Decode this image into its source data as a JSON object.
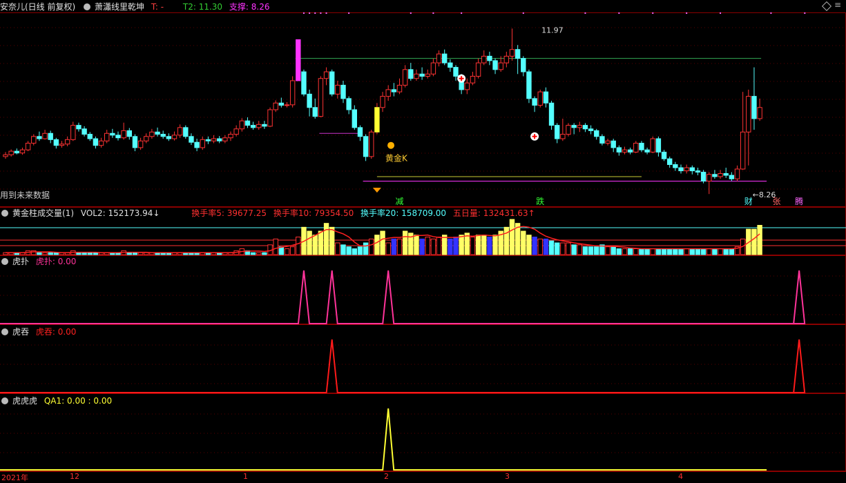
{
  "main": {
    "title": "安奈儿(日线 前复权)",
    "indicator": "萧瀟线里乾坤",
    "t_label": "T: -",
    "t2_label": "T2: 11.30",
    "support_label": "支撑: 8.26",
    "high_label": "11.97",
    "low_label": "8.26",
    "future_text": "用到未来数据",
    "golden_k": "黄金K",
    "sign_jian": "减",
    "sign_die": "跌",
    "sign_cai": "财",
    "sign_zhang": "张",
    "sign_teng": "腾"
  },
  "volume_panel": {
    "title": "黄金柱成交量(1)",
    "vol2": "VOL2: 152173.94↓",
    "hs5": "换手率5: 39677.25",
    "hs10": "换手率10: 79354.50",
    "hs20": "换手率20: 158709.00",
    "wr": "五日量: 132431.63↑"
  },
  "hupu_panel": {
    "title": "虎扑",
    "value": "虎扑: 0.00"
  },
  "hutun_panel": {
    "title": "虎吞",
    "value": "虎吞: 0.00"
  },
  "huhuhu_panel": {
    "title": "虎虎虎",
    "value": "QA1: 0.00 : 0.00"
  },
  "x_axis": {
    "labels": [
      "2021年",
      "12",
      "1",
      "2",
      "3",
      "4"
    ]
  },
  "colors": {
    "up": "#ff3333",
    "down": "#54ffff",
    "hupu": "#ff3399",
    "hutun": "#ff1a1a",
    "huhuhu": "#ffff33",
    "frame": "#8b0000"
  },
  "chart_data": {
    "type": "candlestick",
    "ylim": [
      8.0,
      12.3
    ],
    "candles": [
      [
        9.1,
        9.14,
        9.2,
        9.05
      ],
      [
        9.14,
        9.22,
        9.26,
        9.1
      ],
      [
        9.22,
        9.18,
        9.28,
        9.15
      ],
      [
        9.18,
        9.25,
        9.3,
        9.14
      ],
      [
        9.25,
        9.4,
        9.45,
        9.22
      ],
      [
        9.4,
        9.55,
        9.6,
        9.35
      ],
      [
        9.55,
        9.5,
        9.66,
        9.45
      ],
      [
        9.5,
        9.62,
        9.7,
        9.48
      ],
      [
        9.62,
        9.48,
        9.68,
        9.4
      ],
      [
        9.48,
        9.35,
        9.52,
        9.28
      ],
      [
        9.35,
        9.38,
        9.45,
        9.3
      ],
      [
        9.38,
        9.48,
        9.55,
        9.33
      ],
      [
        9.48,
        9.8,
        9.88,
        9.45
      ],
      [
        9.8,
        9.72,
        9.86,
        9.66
      ],
      [
        9.72,
        9.6,
        9.78,
        9.55
      ],
      [
        9.6,
        9.5,
        9.65,
        9.45
      ],
      [
        9.5,
        9.35,
        9.55,
        9.28
      ],
      [
        9.35,
        9.45,
        9.52,
        9.3
      ],
      [
        9.45,
        9.62,
        9.7,
        9.4
      ],
      [
        9.62,
        9.58,
        9.72,
        9.52
      ],
      [
        9.58,
        9.52,
        9.66,
        9.46
      ],
      [
        9.52,
        9.68,
        9.86,
        9.48
      ],
      [
        9.68,
        9.55,
        9.74,
        9.48
      ],
      [
        9.55,
        9.3,
        9.6,
        9.22
      ],
      [
        9.3,
        9.45,
        9.52,
        9.25
      ],
      [
        9.45,
        9.55,
        9.62,
        9.4
      ],
      [
        9.55,
        9.65,
        9.72,
        9.5
      ],
      [
        9.65,
        9.6,
        9.75,
        9.55
      ],
      [
        9.6,
        9.55,
        9.68,
        9.5
      ],
      [
        9.55,
        9.5,
        9.62,
        9.45
      ],
      [
        9.5,
        9.58,
        9.66,
        9.46
      ],
      [
        9.58,
        9.75,
        9.82,
        9.52
      ],
      [
        9.75,
        9.55,
        9.8,
        9.5
      ],
      [
        9.55,
        9.42,
        9.62,
        9.36
      ],
      [
        9.42,
        9.3,
        9.5,
        9.22
      ],
      [
        9.3,
        9.48,
        9.55,
        9.25
      ],
      [
        9.48,
        9.45,
        9.55,
        9.38
      ],
      [
        9.45,
        9.5,
        9.58,
        9.4
      ],
      [
        9.5,
        9.45,
        9.56,
        9.4
      ],
      [
        9.45,
        9.52,
        9.58,
        9.4
      ],
      [
        9.52,
        9.6,
        9.66,
        9.45
      ],
      [
        9.6,
        9.72,
        9.8,
        9.55
      ],
      [
        9.72,
        9.9,
        9.96,
        9.66
      ],
      [
        9.9,
        9.8,
        9.98,
        9.74
      ],
      [
        9.8,
        9.75,
        9.88,
        9.7
      ],
      [
        9.75,
        9.82,
        9.9,
        9.7
      ],
      [
        9.82,
        9.78,
        9.9,
        9.72
      ],
      [
        9.78,
        10.15,
        10.2,
        9.76
      ],
      [
        10.15,
        10.3,
        10.36,
        10.1
      ],
      [
        10.3,
        10.25,
        10.42,
        10.2
      ],
      [
        10.25,
        10.26,
        10.32,
        10.2
      ],
      [
        10.26,
        10.8,
        10.9,
        10.2
      ],
      [
        10.8,
        11.72,
        11.72,
        10.8
      ],
      [
        11.0,
        10.5,
        11.05,
        10.45
      ],
      [
        10.5,
        10.2,
        10.6,
        10.0
      ],
      [
        10.2,
        10.0,
        10.4,
        9.95
      ],
      [
        10.0,
        10.85,
        10.9,
        9.98
      ],
      [
        10.85,
        11.0,
        11.1,
        10.7
      ],
      [
        11.0,
        10.5,
        11.05,
        10.45
      ],
      [
        10.5,
        10.7,
        10.8,
        10.4
      ],
      [
        10.7,
        10.4,
        10.8,
        10.3
      ],
      [
        10.4,
        10.15,
        10.45,
        10.05
      ],
      [
        10.15,
        9.75,
        10.25,
        9.7
      ],
      [
        9.75,
        9.55,
        9.8,
        9.45
      ],
      [
        9.55,
        9.1,
        9.6,
        9.0
      ],
      [
        9.1,
        9.65,
        9.7,
        9.05
      ],
      [
        9.65,
        10.2,
        10.3,
        9.6
      ],
      [
        10.2,
        10.45,
        10.55,
        10.1
      ],
      [
        10.45,
        10.6,
        10.7,
        10.35
      ],
      [
        10.6,
        10.55,
        10.75,
        10.45
      ],
      [
        10.55,
        10.7,
        10.85,
        10.5
      ],
      [
        10.7,
        11.05,
        11.15,
        10.65
      ],
      [
        11.05,
        10.85,
        11.2,
        10.8
      ],
      [
        10.85,
        10.95,
        11.05,
        10.8
      ],
      [
        10.95,
        10.9,
        11.1,
        10.82
      ],
      [
        10.9,
        10.95,
        11.05,
        10.85
      ],
      [
        10.95,
        11.2,
        11.3,
        10.9
      ],
      [
        11.2,
        11.4,
        11.48,
        11.12
      ],
      [
        11.4,
        11.2,
        11.5,
        11.15
      ],
      [
        11.2,
        11.1,
        11.28,
        11.0
      ],
      [
        11.1,
        10.9,
        11.15,
        10.8
      ],
      [
        10.9,
        10.6,
        10.95,
        10.5
      ],
      [
        10.6,
        10.75,
        10.85,
        10.5
      ],
      [
        10.75,
        10.9,
        11.0,
        10.7
      ],
      [
        10.9,
        11.2,
        11.3,
        10.85
      ],
      [
        11.2,
        11.35,
        11.48,
        11.15
      ],
      [
        11.35,
        11.25,
        11.45,
        11.15
      ],
      [
        11.25,
        11.05,
        11.3,
        10.95
      ],
      [
        11.05,
        11.2,
        11.35,
        11.0
      ],
      [
        11.2,
        11.35,
        11.45,
        11.1
      ],
      [
        11.35,
        11.5,
        11.97,
        11.25
      ],
      [
        11.5,
        11.3,
        11.6,
        10.95
      ],
      [
        11.3,
        11.0,
        11.35,
        10.9
      ],
      [
        11.0,
        10.4,
        11.05,
        10.3
      ],
      [
        10.4,
        10.25,
        10.45,
        10.1
      ],
      [
        10.25,
        10.55,
        10.6,
        10.2
      ],
      [
        10.55,
        10.3,
        10.65,
        10.2
      ],
      [
        10.3,
        9.8,
        10.35,
        9.7
      ],
      [
        9.8,
        9.5,
        9.85,
        9.4
      ],
      [
        9.5,
        9.6,
        9.95,
        9.45
      ],
      [
        9.6,
        9.8,
        9.85,
        9.55
      ],
      [
        9.8,
        9.75,
        9.85,
        9.6
      ],
      [
        9.75,
        9.8,
        9.88,
        9.65
      ],
      [
        9.8,
        9.72,
        9.85,
        9.65
      ],
      [
        9.72,
        9.68,
        9.8,
        9.6
      ],
      [
        9.68,
        9.55,
        9.72,
        9.48
      ],
      [
        9.55,
        9.4,
        9.6,
        9.35
      ],
      [
        9.4,
        9.45,
        9.5,
        9.35
      ],
      [
        9.45,
        9.3,
        9.5,
        9.2
      ],
      [
        9.3,
        9.2,
        9.35,
        9.12
      ],
      [
        9.2,
        9.25,
        9.32,
        9.15
      ],
      [
        9.25,
        9.2,
        9.3,
        9.15
      ],
      [
        9.2,
        9.4,
        9.45,
        9.18
      ],
      [
        9.4,
        9.25,
        9.45,
        9.2
      ],
      [
        9.25,
        9.2,
        9.3,
        9.15
      ],
      [
        9.2,
        9.5,
        9.55,
        9.18
      ],
      [
        9.5,
        9.2,
        9.55,
        9.1
      ],
      [
        9.2,
        9.05,
        9.25,
        9.0
      ],
      [
        9.05,
        8.92,
        9.1,
        8.85
      ],
      [
        8.92,
        8.85,
        8.98,
        8.78
      ],
      [
        8.85,
        8.78,
        8.92,
        8.72
      ],
      [
        8.78,
        8.85,
        8.92,
        8.72
      ],
      [
        8.85,
        8.78,
        8.9,
        8.7
      ],
      [
        8.78,
        8.75,
        8.85,
        8.68
      ],
      [
        8.75,
        8.55,
        8.8,
        8.5
      ],
      [
        8.55,
        8.7,
        8.75,
        8.26
      ],
      [
        8.7,
        8.65,
        8.8,
        8.6
      ],
      [
        8.65,
        8.72,
        8.8,
        8.6
      ],
      [
        8.72,
        8.68,
        8.85,
        8.62
      ],
      [
        8.68,
        8.6,
        8.75,
        8.55
      ],
      [
        8.6,
        8.82,
        8.9,
        8.55
      ],
      [
        8.82,
        9.65,
        10.55,
        8.8
      ],
      [
        9.65,
        10.45,
        10.6,
        8.9
      ],
      [
        10.45,
        9.95,
        11.1,
        9.7
      ],
      [
        9.95,
        10.2,
        10.4,
        9.9
      ]
    ],
    "volume": [
      1,
      1,
      1,
      1,
      2,
      2,
      1,
      1,
      1,
      1,
      1,
      1,
      2,
      1,
      1,
      1,
      1,
      1,
      1,
      1,
      1,
      2,
      1,
      1,
      1,
      1,
      1,
      1,
      1,
      1,
      1,
      1,
      1,
      1,
      1,
      1,
      1,
      1,
      1,
      1,
      1,
      2,
      3,
      2,
      1,
      1,
      1,
      5,
      8,
      4,
      3,
      4,
      9,
      14,
      12,
      10,
      12,
      16,
      14,
      6,
      5,
      4,
      3,
      4,
      6,
      8,
      10,
      12,
      6,
      8,
      8,
      12,
      11,
      10,
      8,
      9,
      8,
      9,
      10,
      8,
      9,
      10,
      11,
      9,
      10,
      10,
      9,
      10,
      12,
      14,
      18,
      16,
      12,
      10,
      9,
      8,
      8,
      7,
      6,
      6,
      6,
      5,
      5,
      4,
      4,
      4,
      5,
      4,
      4,
      3,
      3,
      3,
      3,
      3,
      3,
      3,
      3,
      3,
      3,
      3,
      3,
      3,
      3,
      3,
      3,
      3,
      3,
      3,
      3,
      3,
      4,
      8,
      13,
      13,
      15
    ],
    "hupu_peaks": [
      53,
      58,
      68,
      141
    ],
    "hutun_peaks": [
      58,
      141
    ],
    "huhuhu_peaks": [
      68
    ]
  }
}
